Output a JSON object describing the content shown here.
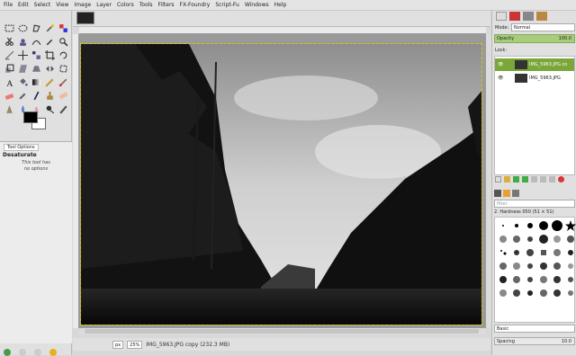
{
  "menu": [
    "File",
    "Edit",
    "Select",
    "View",
    "Image",
    "Layer",
    "Colors",
    "Tools",
    "Filters",
    "FX-Foundry",
    "Script-Fu",
    "Windows",
    "Help"
  ],
  "tool_options": {
    "tab_label": "Tool Options",
    "tool_name": "Desaturate",
    "message_line1": "This tool has",
    "message_line2": "no options"
  },
  "status": {
    "unit": "px",
    "zoom": "25%",
    "text": "IMG_5963.JPG copy (232.3 MB)"
  },
  "dock": {
    "mode_label": "Mode:",
    "mode_value": "Normal",
    "opacity_label": "Opacity",
    "opacity_value": "100.0",
    "lock_label": "Lock:",
    "layers": [
      {
        "name": "IMG_5963.JPG co"
      },
      {
        "name": "IMG_5963.JPG"
      }
    ],
    "filter_placeholder": "filter",
    "brush_name": "2. Hardness 050 (51 × 51)",
    "brush_set": "Basic",
    "spacing_label": "Spacing",
    "spacing_value": "10.0"
  },
  "colors": {
    "selection_marching_ants": "#d8c300",
    "opacity_bar": "#a6ce7a",
    "selected_layer": "#7aa63a"
  }
}
